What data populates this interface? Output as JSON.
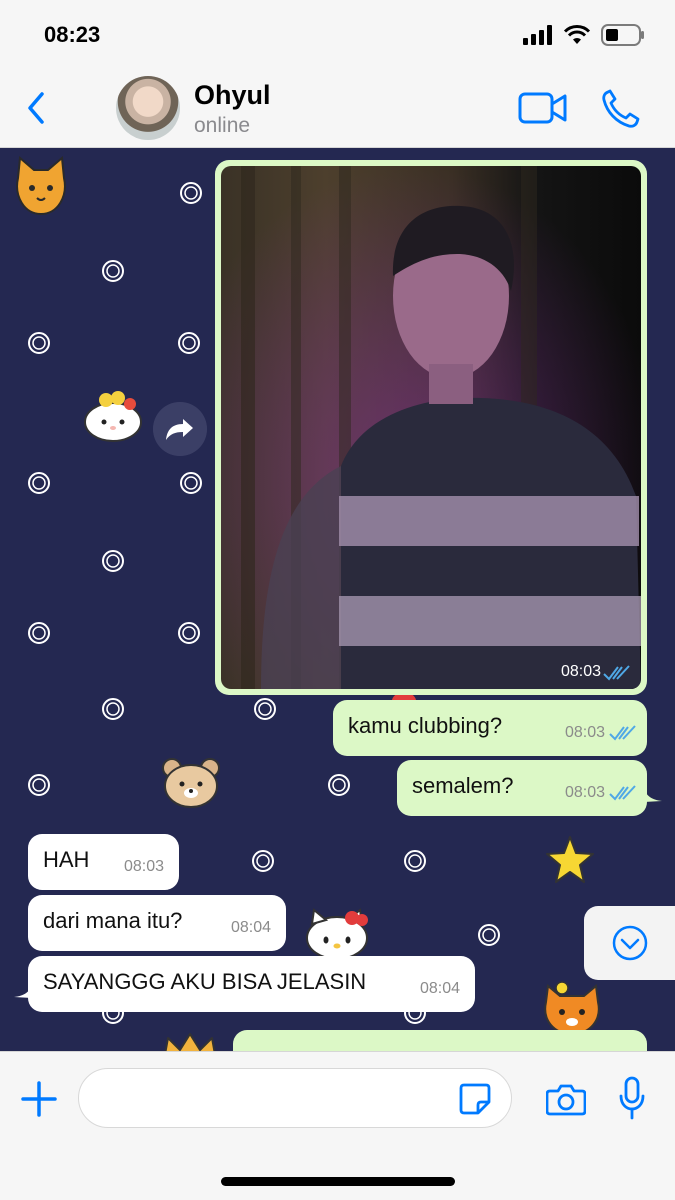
{
  "status_bar": {
    "time": "08:23"
  },
  "header": {
    "contact_name": "Ohyul",
    "contact_status": "online",
    "back_icon": "chevron-left-icon",
    "video_icon": "video-camera-icon",
    "call_icon": "phone-icon"
  },
  "colors": {
    "accent": "#007aff",
    "outgoing_bubble": "#dcf8c6",
    "incoming_bubble": "#ffffff",
    "chat_background": "#242851",
    "read_ticks": "#4fa8e6"
  },
  "messages": {
    "photo": {
      "time": "08:03",
      "status": "read"
    },
    "m1": {
      "text": "kamu clubbing?",
      "time": "08:03",
      "status": "read"
    },
    "m2": {
      "text": "semalem?",
      "time": "08:03",
      "status": "read"
    },
    "m3": {
      "text": "HAH",
      "time": "08:03"
    },
    "m4": {
      "text": "dari mana itu?",
      "time": "08:04"
    },
    "m5": {
      "text": "SAYANGGG AKU BISA JELASIN",
      "time": "08:04"
    }
  },
  "input_bar": {
    "placeholder": "",
    "plus_icon": "plus-icon",
    "sticker_icon": "sticker-icon",
    "camera_icon": "camera-icon",
    "mic_icon": "microphone-icon"
  }
}
